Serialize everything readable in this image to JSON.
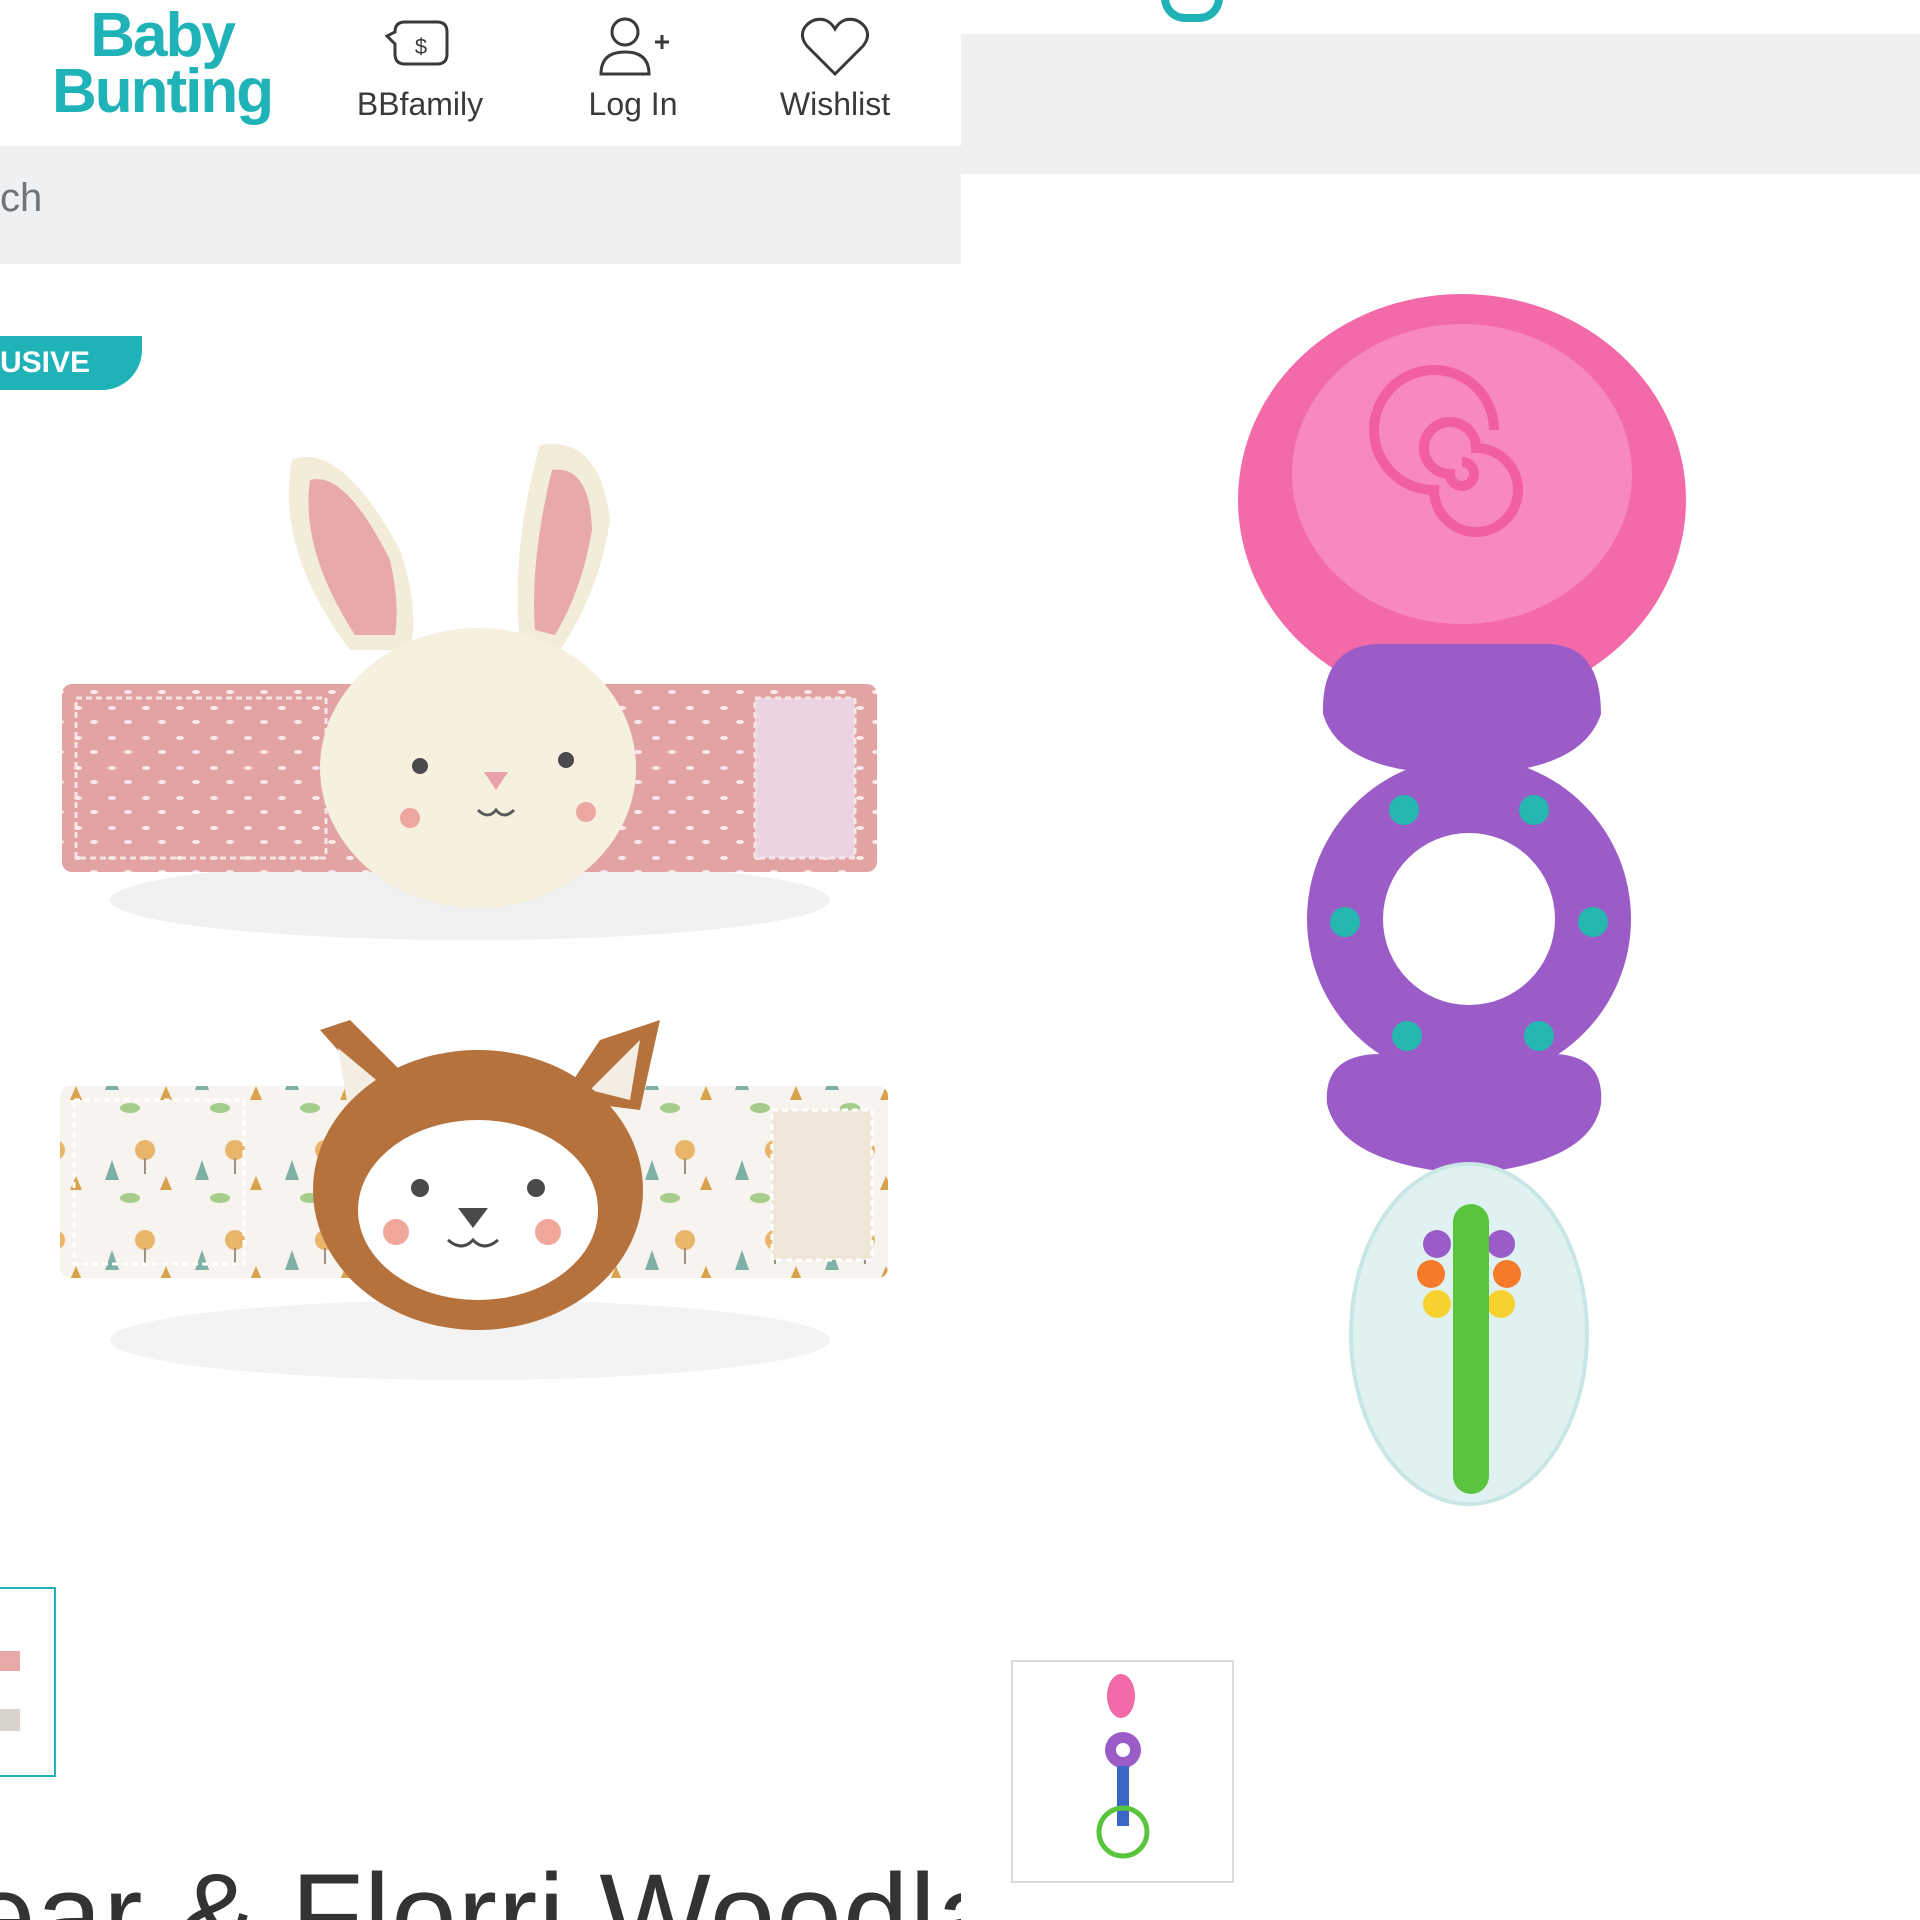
{
  "left": {
    "logo": {
      "line1": "Baby",
      "line2": "Bunting"
    },
    "nav": [
      {
        "label": "BBfamily",
        "icon": "bbfamily-icon"
      },
      {
        "label": "Log In",
        "icon": "user-add-icon"
      },
      {
        "label": "Wishlist",
        "icon": "heart-icon"
      }
    ],
    "search": {
      "text": "ch"
    },
    "badge": "USIVE",
    "product_title": "ear & Florri Woodland"
  },
  "right": {
    "product_image": "teether-rattle",
    "thumbnail": "teether-rattle-thumbnail"
  },
  "colors": {
    "brand": "#1fb3b8",
    "search_bg": "#eef0f2",
    "text": "#3a3a3a"
  }
}
